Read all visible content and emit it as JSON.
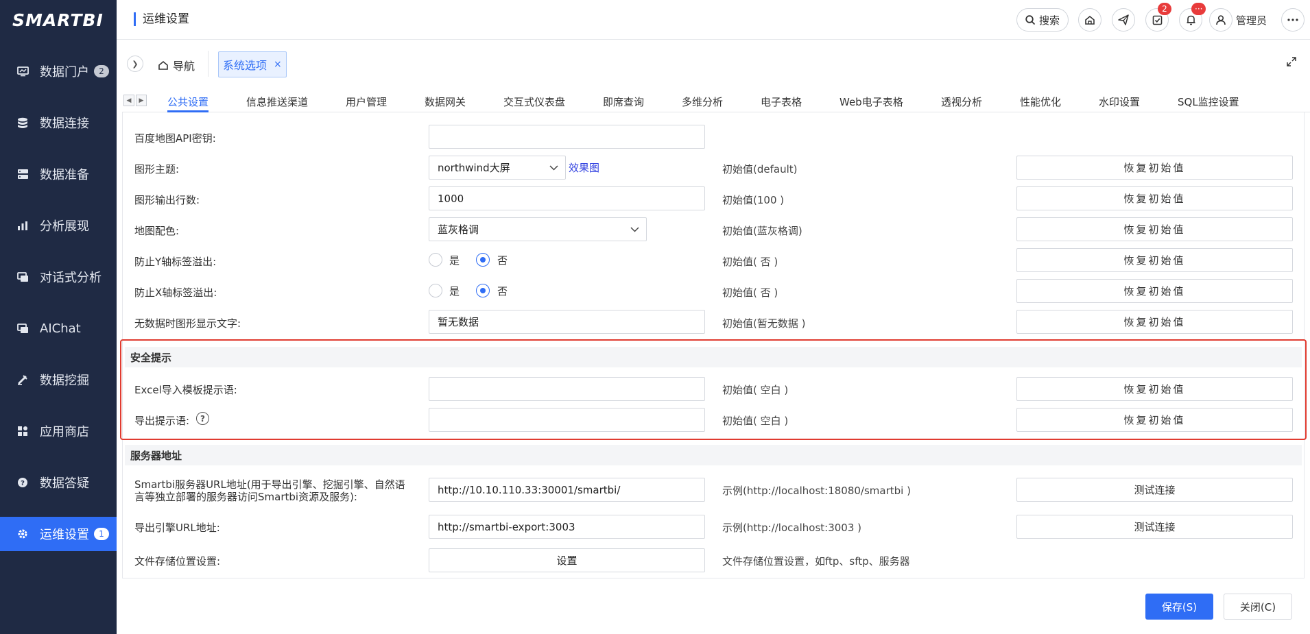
{
  "brand": {
    "logo_text": "SMARTBI"
  },
  "sidebar": {
    "items": [
      {
        "label": "数据门户",
        "icon": "portal-icon",
        "badge": "2"
      },
      {
        "label": "数据连接",
        "icon": "database-icon"
      },
      {
        "label": "数据准备",
        "icon": "server-icon"
      },
      {
        "label": "分析展现",
        "icon": "bar-chart-icon"
      },
      {
        "label": "对话式分析",
        "icon": "chat-analysis-icon"
      },
      {
        "label": "AIChat",
        "icon": "ai-chat-icon"
      },
      {
        "label": "数据挖掘",
        "icon": "pickaxe-icon"
      },
      {
        "label": "应用商店",
        "icon": "app-grid-icon"
      },
      {
        "label": "数据答疑",
        "icon": "question-icon"
      },
      {
        "label": "运维设置",
        "icon": "gear-icon",
        "badge": "1",
        "active": true
      }
    ]
  },
  "header": {
    "title": "运维设置",
    "search_label": "搜索",
    "task_badge": "2",
    "notify_badge": "···",
    "user_name": "管理员"
  },
  "tabs": {
    "nav_label": "导航",
    "open_tab_label": "系统选项",
    "close_glyph": "×"
  },
  "subtabs": [
    "公共设置",
    "信息推送渠道",
    "用户管理",
    "数据网关",
    "交互式仪表盘",
    "即席查询",
    "多维分析",
    "电子表格",
    "Web电子表格",
    "透视分析",
    "性能优化",
    "水印设置",
    "SQL监控设置"
  ],
  "form": {
    "reset_label": "恢复初始值",
    "rows": [
      {
        "label": "百度地图API密钥:",
        "value": ""
      },
      {
        "label": "图形主题:",
        "value": "northwind大屏",
        "link": "效果图",
        "initial": "初始值(default)"
      },
      {
        "label": "图形输出行数:",
        "value": "1000",
        "initial": "初始值(100 )"
      },
      {
        "label": "地图配色:",
        "value": "蓝灰格调",
        "initial": "初始值(蓝灰格调)"
      },
      {
        "label": "防止Y轴标签溢出:",
        "opt_yes": "是",
        "opt_no": "否",
        "initial": "初始值( 否 )"
      },
      {
        "label": "防止X轴标签溢出:",
        "opt_yes": "是",
        "opt_no": "否",
        "initial": "初始值( 否 )"
      },
      {
        "label": "无数据时图形显示文字:",
        "value": "暂无数据",
        "initial": "初始值(暂无数据 )"
      }
    ],
    "security": {
      "title": "安全提示",
      "rows": [
        {
          "label": "Excel导入模板提示语:",
          "value": "",
          "initial": "初始值( 空白 )"
        },
        {
          "label": "导出提示语:",
          "value": "",
          "initial": "初始值( 空白 )"
        }
      ]
    },
    "server": {
      "title": "服务器地址",
      "rows": [
        {
          "label_line1": "Smartbi服务器URL地址(用于导出引擎、挖掘引擎、自然语",
          "label_line2": "言等独立部署的服务器访问Smartbi资源及服务):",
          "value": "http://10.10.110.33:30001/smartbi/",
          "initial": "示例(http://localhost:18080/smartbi )",
          "button": "测试连接"
        },
        {
          "label": "导出引擎URL地址:",
          "value": "http://smartbi-export:3003",
          "initial": "示例(http://localhost:3003 )",
          "button": "测试连接"
        },
        {
          "label": "文件存储位置设置:",
          "value": "设置",
          "initial": "文件存储位置设置，如ftp、sftp、服务器"
        }
      ]
    }
  },
  "footer": {
    "save_label": "保存(S)",
    "close_label": "关闭(C)"
  },
  "colors": {
    "sidebar_bg": "#1f2a44",
    "accent": "#2f6df5",
    "highlight_border": "#e03b30",
    "badge_red": "#e83b3b"
  }
}
